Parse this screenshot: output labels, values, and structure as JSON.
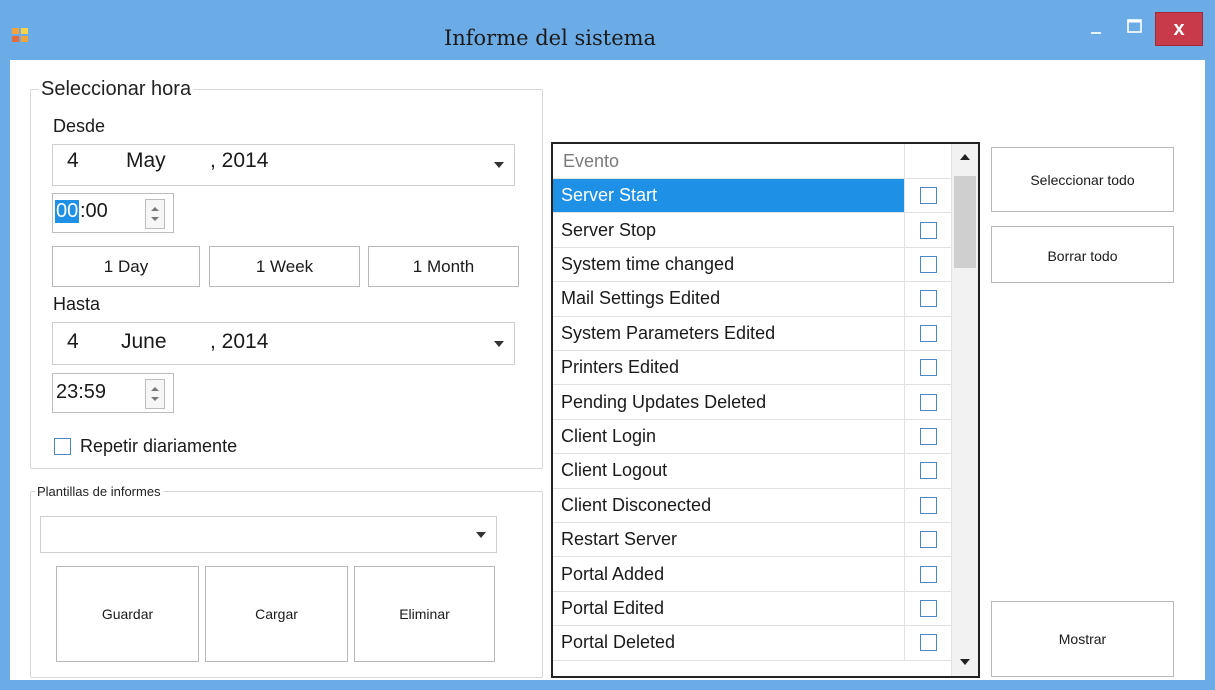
{
  "window": {
    "title": "Informe del sistema",
    "close_glyph": "x",
    "accent": "#6cace6",
    "close_color": "#c8394a"
  },
  "time_group": {
    "legend": "Seleccionar hora",
    "from_label": "Desde",
    "from_date": {
      "day": "4",
      "month": "May",
      "year": ", 2014"
    },
    "from_time": {
      "hour": "00",
      "sep_min": ":00"
    },
    "quick": {
      "day": "1 Day",
      "week": "1 Week",
      "month": "1 Month"
    },
    "to_label": "Hasta",
    "to_date": {
      "day": "4",
      "month": "June",
      "year": ", 2014"
    },
    "to_time": "23:59",
    "repeat_label": "Repetir diariamente"
  },
  "templates": {
    "legend": "Plantillas de informes",
    "selected": "",
    "save": "Guardar",
    "load": "Cargar",
    "delete": "Eliminar"
  },
  "events": {
    "header": "Evento",
    "selected_index": 0,
    "rows": [
      "Server Start",
      "Server Stop",
      "System time changed",
      "Mail Settings Edited",
      "System Parameters Edited",
      "Printers Edited",
      "Pending Updates Deleted",
      "Client Login",
      "Client Logout",
      "Client Disconected",
      "Restart Server",
      "Portal Added",
      "Portal Edited",
      "Portal Deleted"
    ]
  },
  "actions": {
    "select_all": "Seleccionar todo",
    "clear_all": "Borrar todo",
    "show": "Mostrar"
  }
}
